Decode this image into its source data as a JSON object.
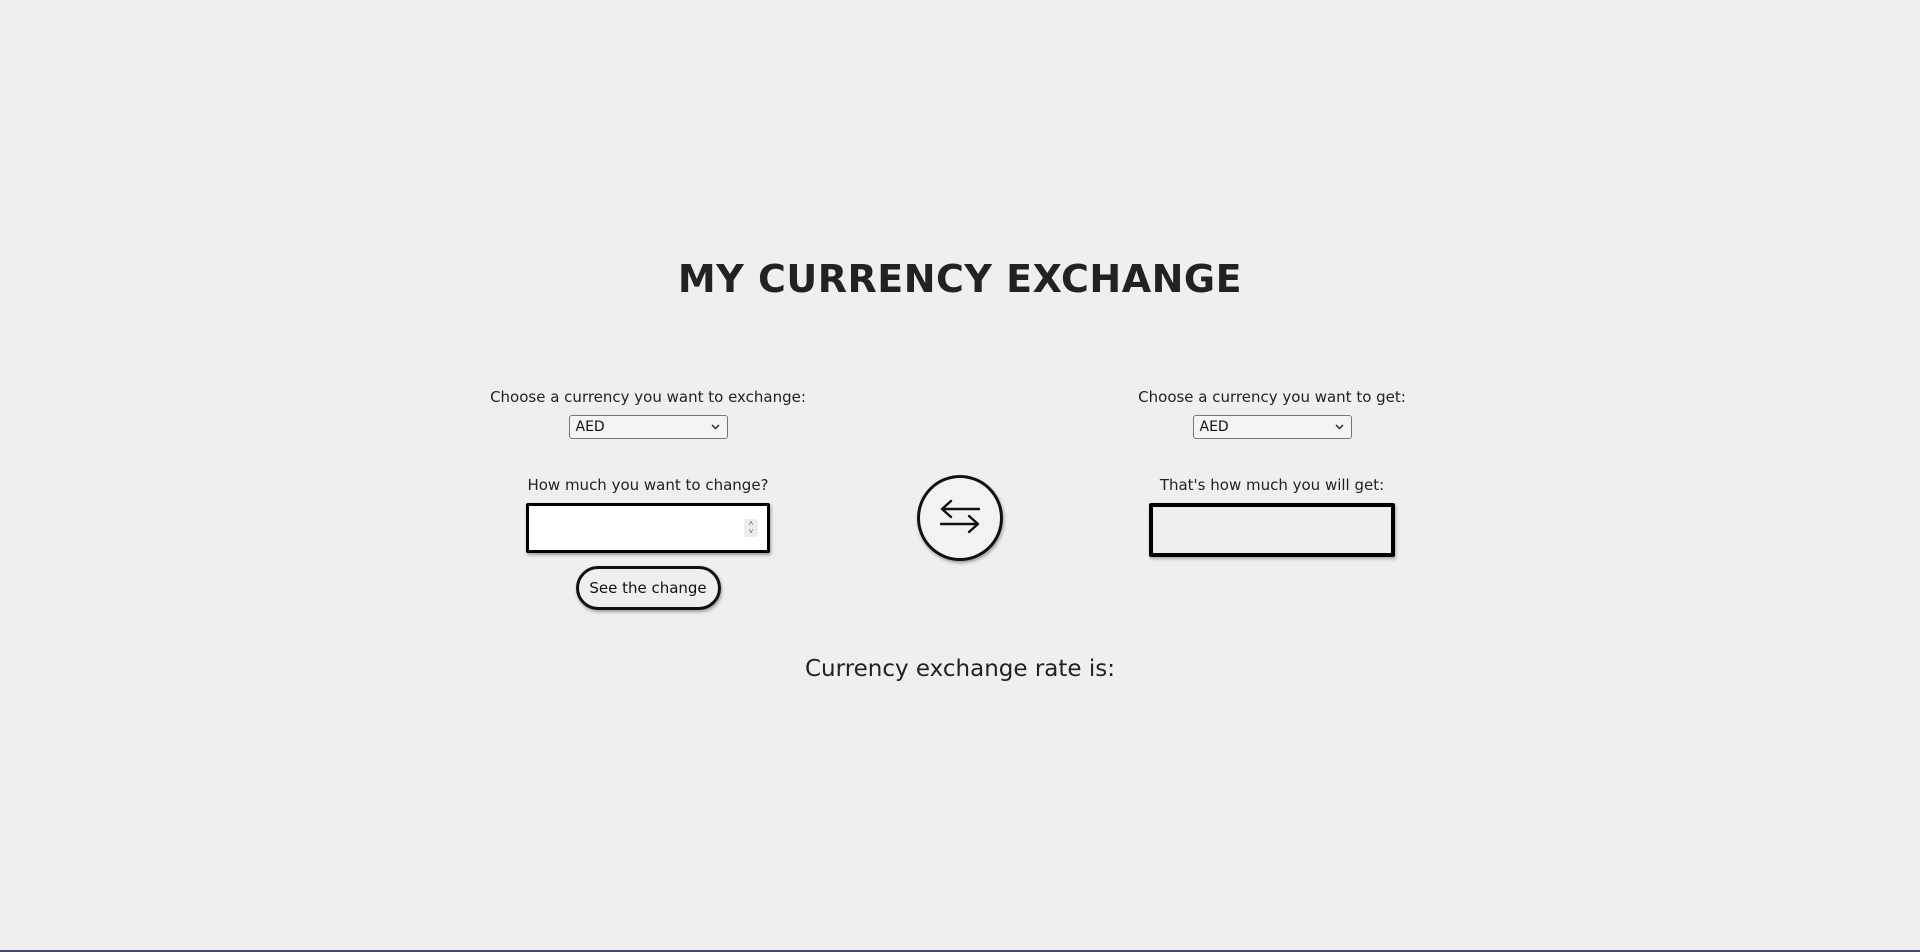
{
  "title": "MY CURRENCY EXCHANGE",
  "from": {
    "label": "Choose a currency you want to exchange:",
    "selected_currency": "AED",
    "amount_label": "How much you want to change?",
    "amount_value": "",
    "button_label": "See the change"
  },
  "to": {
    "label": "Choose a currency you want to get:",
    "selected_currency": "AED",
    "result_label": "That's how much you will get:",
    "result_value": ""
  },
  "swap": {
    "icon": "swap-arrows-icon"
  },
  "rate": {
    "label": "Currency exchange rate is:"
  }
}
